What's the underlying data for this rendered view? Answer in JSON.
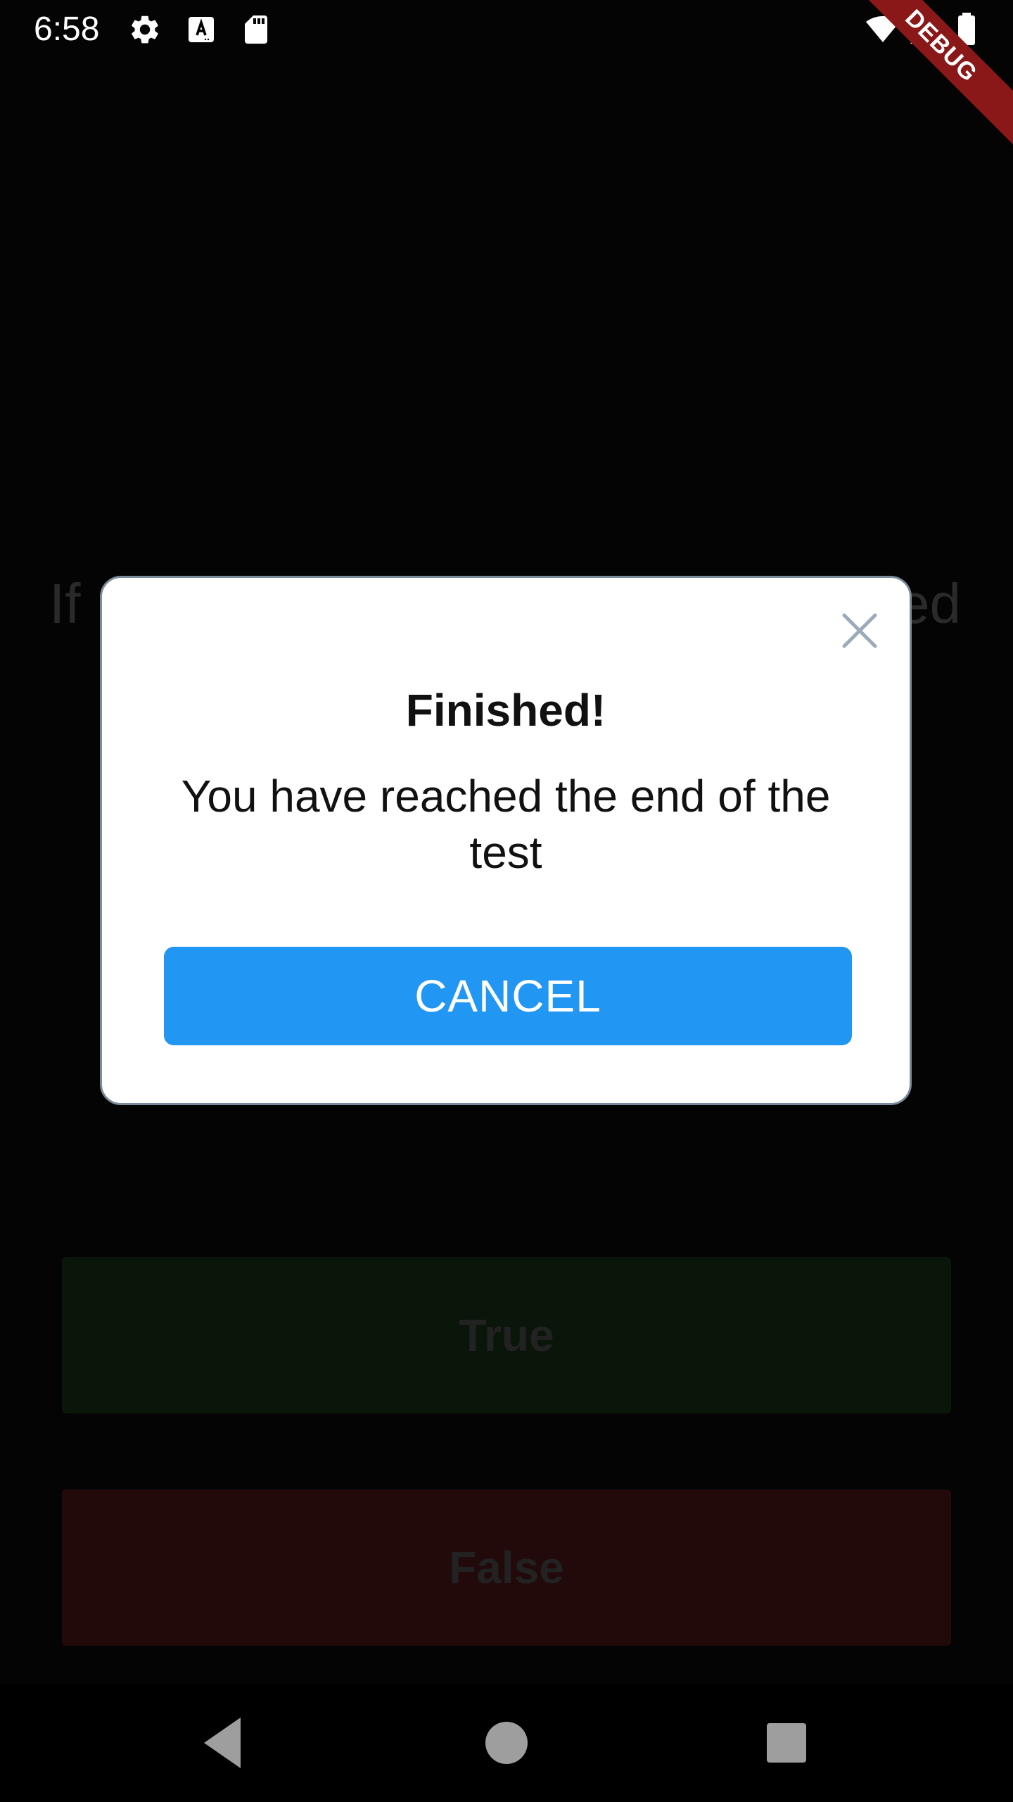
{
  "status_bar": {
    "time": "6:58",
    "icons": [
      "settings-icon",
      "font-a-icon",
      "sd-card-icon",
      "wifi-icon",
      "signal-icon",
      "battery-icon"
    ]
  },
  "debug_banner": "DEBUG",
  "background": {
    "question_left": "If",
    "question_right": "ed",
    "true_label": "True",
    "false_label": "False",
    "colors": {
      "true_bg": "#0b160b",
      "false_bg": "#220a0a"
    }
  },
  "dialog": {
    "title": "Finished!",
    "message": "You have reached the end of the test",
    "cancel_label": "CANCEL",
    "close_icon": "close-icon",
    "colors": {
      "button": "#2196f3",
      "border": "#7a8c9c",
      "close": "#9aaab8"
    }
  },
  "nav_bar": {
    "icons": [
      "back-icon",
      "home-icon",
      "recents-icon"
    ]
  }
}
